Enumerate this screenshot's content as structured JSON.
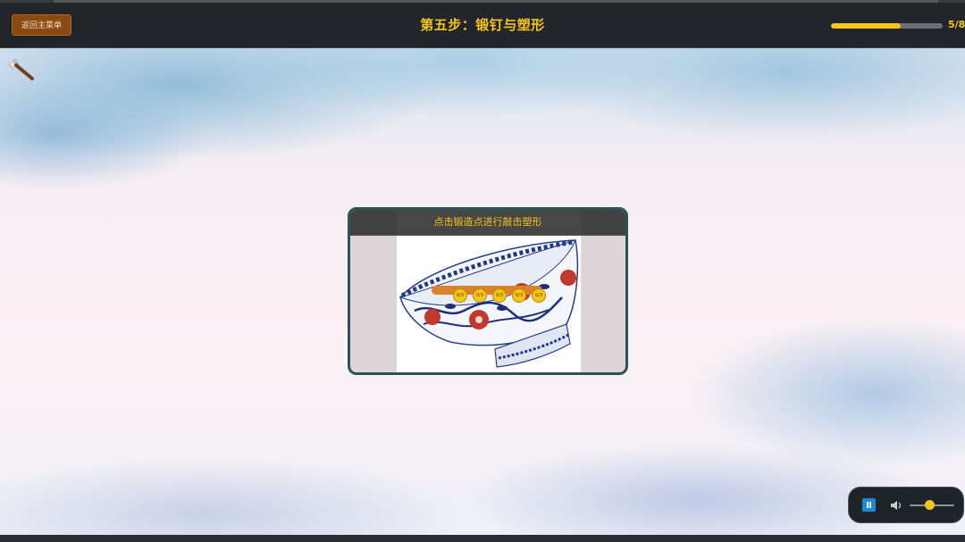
{
  "header": {
    "back_button": "返回主菜单",
    "step_title": "第五步：锻钉与塑形",
    "progress": {
      "current": 5,
      "total": 8,
      "text": "5/8",
      "fraction": 0.625
    }
  },
  "cursor_icon": "hammer-icon",
  "panel": {
    "instruction": "点击锻造点进行敲击塑形",
    "image": "blue-and-white-porcelain-bowl",
    "forge_points": [
      {
        "label": "0/3"
      },
      {
        "label": "0/3"
      },
      {
        "label": "0/3"
      },
      {
        "label": "0/3"
      },
      {
        "label": "0/3"
      }
    ]
  },
  "audio": {
    "play_state_icon": "pause-icon",
    "volume_icon": "speaker-icon",
    "volume_level": 0.45
  },
  "colors": {
    "accent": "#f5c518",
    "header_bg": "#22262a",
    "back_button_bg": "#8a4a12",
    "forge_bar": "#d9822b",
    "panel_border": "#2f5257",
    "audio_play": "#1e88d8"
  }
}
